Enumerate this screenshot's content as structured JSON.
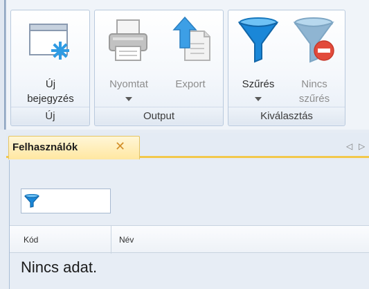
{
  "ribbon": {
    "groups": [
      {
        "label": "Új",
        "buttons": [
          {
            "label_line1": "Új",
            "label_line2": "bejegyzés",
            "icon": "new-entry-icon"
          }
        ]
      },
      {
        "label": "Output",
        "buttons": [
          {
            "label": "Nyomtat",
            "icon": "printer-icon",
            "has_dropdown": true
          },
          {
            "label": "Export",
            "icon": "export-icon"
          }
        ]
      },
      {
        "label": "Kiválasztás",
        "buttons": [
          {
            "label": "Szűrés",
            "icon": "filter-icon",
            "has_dropdown": true
          },
          {
            "label_line1": "Nincs",
            "label_line2": "szűrés",
            "icon": "no-filter-icon"
          }
        ]
      }
    ]
  },
  "tabs": [
    {
      "label": "Felhasználók",
      "close_glyph": "✕"
    }
  ],
  "tab_nav": {
    "left": "◁",
    "right": "▷"
  },
  "grid": {
    "columns": [
      "Kód",
      "Név"
    ],
    "empty_text": "Nincs adat."
  },
  "colors": {
    "filter_blue": "#1a87d8",
    "no_filter_red": "#e24b3b",
    "tab_active": "#ffe7a1"
  }
}
